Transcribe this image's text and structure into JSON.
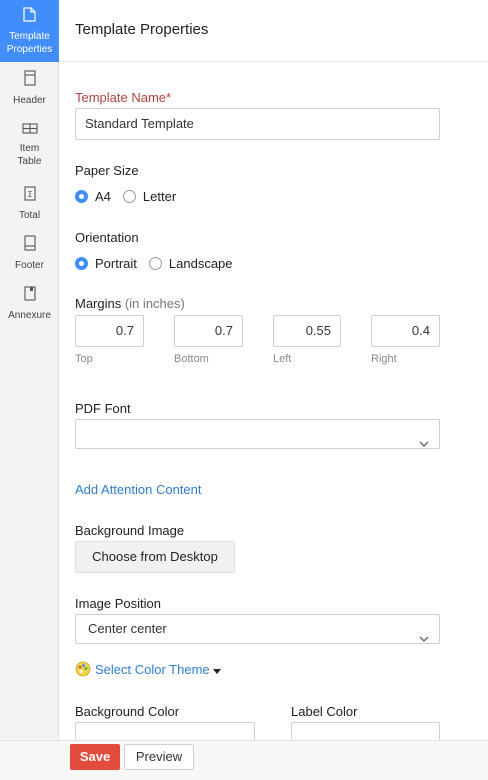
{
  "sidebar": {
    "items": [
      {
        "label_line1": "Template",
        "label_line2": "Properties",
        "icon": "document-icon",
        "active": true
      },
      {
        "label_line1": "Header",
        "label_line2": "",
        "icon": "header-icon",
        "active": false
      },
      {
        "label_line1": "Item",
        "label_line2": "Table",
        "icon": "table-icon",
        "active": false
      },
      {
        "label_line1": "Total",
        "label_line2": "",
        "icon": "sigma-icon",
        "active": false
      },
      {
        "label_line1": "Footer",
        "label_line2": "",
        "icon": "footer-icon",
        "active": false
      },
      {
        "label_line1": "Annexure",
        "label_line2": "",
        "icon": "annexure-icon",
        "active": false
      }
    ]
  },
  "header": {
    "title": "Template Properties"
  },
  "template_name": {
    "label": "Template Name*",
    "value": "Standard Template"
  },
  "paper_size": {
    "label": "Paper Size",
    "options": [
      "A4",
      "Letter"
    ],
    "selected": "A4"
  },
  "orientation": {
    "label": "Orientation",
    "options": [
      "Portrait",
      "Landscape"
    ],
    "selected": "Portrait"
  },
  "margins": {
    "label": "Margins",
    "unit_note": "(in inches)",
    "fields": [
      {
        "name": "Top",
        "value": "0.7"
      },
      {
        "name": "Bottom",
        "value": "0.7"
      },
      {
        "name": "Left",
        "value": "0.55"
      },
      {
        "name": "Right",
        "value": "0.4"
      }
    ]
  },
  "pdf_font": {
    "label": "PDF Font",
    "value": ""
  },
  "attention": {
    "link": "Add Attention Content"
  },
  "background_image": {
    "label": "Background Image",
    "button": "Choose from Desktop"
  },
  "image_position": {
    "label": "Image Position",
    "value": "Center center"
  },
  "color_theme": {
    "link": "Select Color Theme"
  },
  "colors": {
    "background_label": "Background Color",
    "label_label": "Label Color"
  },
  "footer": {
    "save": "Save",
    "preview": "Preview"
  },
  "theme": {
    "accent": "#408dfb",
    "link": "#2f7dd3",
    "save": "#e34c3c",
    "required": "#b14141"
  }
}
